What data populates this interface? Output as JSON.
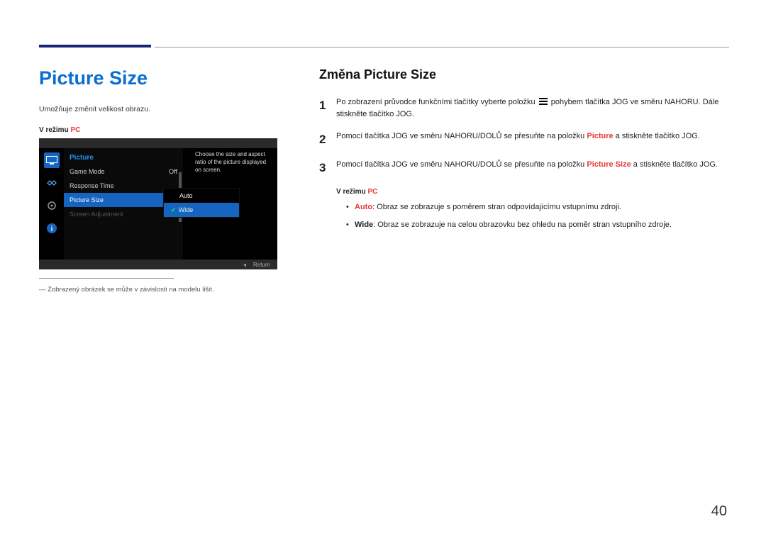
{
  "pageNumber": "40",
  "left": {
    "title": "Picture Size",
    "desc": "Umožňuje změnit velikost obrazu.",
    "modeLabelPrefix": "V režimu ",
    "modeLabelSuffix": "PC",
    "footnote": "Zobrazený obrázek se může v závislosti na modelu lišit."
  },
  "osd": {
    "panelTitle": "Picture",
    "rows": {
      "gameMode": {
        "label": "Game Mode",
        "value": "Off"
      },
      "responseTime": {
        "label": "Response Time"
      },
      "pictureSize": {
        "label": "Picture Size"
      },
      "screenAdjustment": {
        "label": "Screen Adjustment"
      }
    },
    "submenu": {
      "auto": "Auto",
      "wide": "Wide"
    },
    "hint": "Choose the size and aspect ratio of the picture displayed on screen.",
    "footer": {
      "arrow": "◂",
      "return": "Return"
    }
  },
  "right": {
    "title": "Změna Picture Size",
    "step1a": "Po zobrazení průvodce funkčními tlačítky vyberte položku ",
    "step1b": " pohybem tlačítka JOG ve směru NAHORU. Dále stiskněte tlačítko JOG.",
    "step2": {
      "pre": "Pomocí tlačítka JOG ve směru NAHORU/DOLŮ se přesuňte na položku ",
      "hl": "Picture",
      "post": " a stiskněte tlačítko JOG."
    },
    "step3": {
      "pre": "Pomocí tlačítka JOG ve směru NAHORU/DOLŮ se přesuňte na položku ",
      "hl": "Picture Size",
      "post": " a stiskněte tlačítko JOG."
    },
    "subModePrefix": "V režimu ",
    "subModeSuffix": "PC",
    "bullets": {
      "auto": {
        "lead": "Auto",
        "text": ": Obraz se zobrazuje s poměrem stran odpovídajícímu vstupnímu zdroji."
      },
      "wide": {
        "lead": "Wide",
        "text": ": Obraz se zobrazuje na celou obrazovku bez ohledu na poměr stran vstupního zdroje."
      }
    },
    "numbers": {
      "n1": "1",
      "n2": "2",
      "n3": "3"
    }
  }
}
